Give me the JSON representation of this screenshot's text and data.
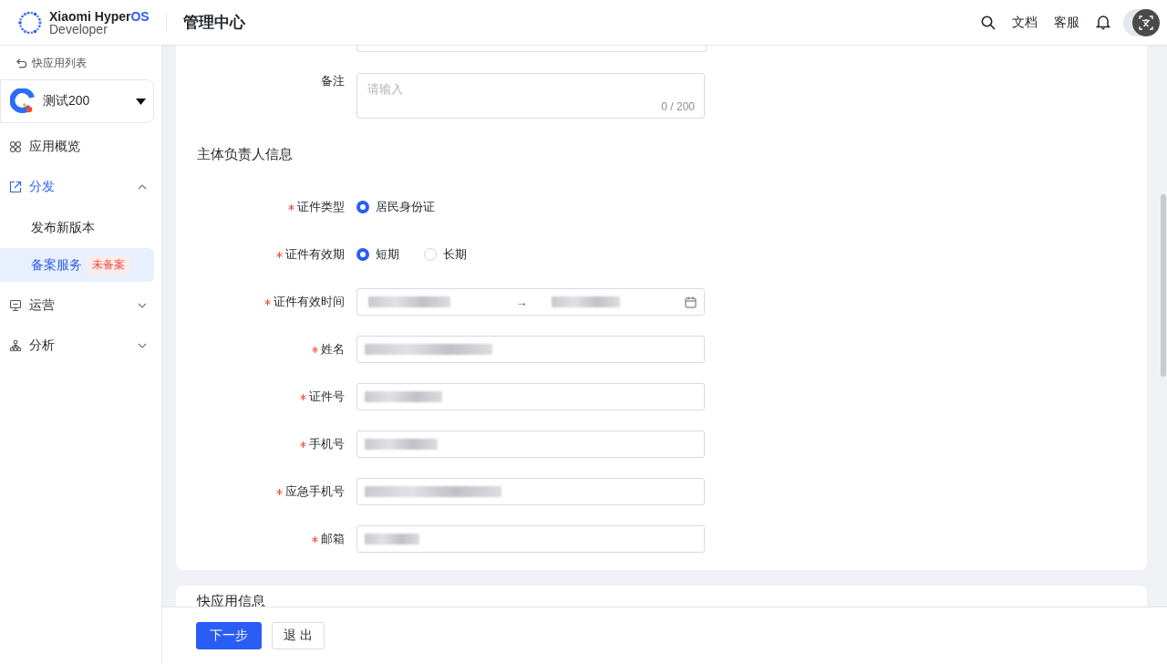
{
  "header": {
    "brand": "Xiaomi Hyper",
    "brand_accent": "OS",
    "subtitle": "Developer",
    "title": "管理中心",
    "links": [
      "文档",
      "客服"
    ]
  },
  "sidebar": {
    "back_link": "快应用列表",
    "app": {
      "name": "测试200"
    },
    "menu": [
      {
        "label": "应用概览",
        "kind": "link",
        "selected": false
      },
      {
        "label": "分发",
        "kind": "group",
        "selected": true,
        "expanded": true,
        "children": [
          {
            "label": "发布新版本",
            "selected": false
          },
          {
            "label": "备案服务",
            "selected": true,
            "badge": "未备案"
          }
        ]
      },
      {
        "label": "运营",
        "kind": "group",
        "selected": false,
        "expanded": false
      },
      {
        "label": "分析",
        "kind": "group",
        "selected": false,
        "expanded": false
      }
    ]
  },
  "form": {
    "note": {
      "label": "备注",
      "placeholder": "请输入",
      "counter": "0 / 200"
    },
    "section_title": "主体负责人信息",
    "fields": [
      {
        "label": "证件类型",
        "required": true,
        "kind": "radio",
        "options": [
          {
            "label": "居民身份证",
            "selected": true
          }
        ]
      },
      {
        "label": "证件有效期",
        "required": true,
        "kind": "radio",
        "options": [
          {
            "label": "短期",
            "selected": true
          },
          {
            "label": "长期",
            "selected": false
          }
        ]
      },
      {
        "label": "证件有效时间",
        "required": true,
        "kind": "daterange",
        "separator": "→"
      },
      {
        "label": "姓名",
        "required": true,
        "kind": "text"
      },
      {
        "label": "证件号",
        "required": true,
        "kind": "text"
      },
      {
        "label": "手机号",
        "required": true,
        "kind": "text"
      },
      {
        "label": "应急手机号",
        "required": true,
        "kind": "text"
      },
      {
        "label": "邮箱",
        "required": true,
        "kind": "text"
      }
    ],
    "next_section_title": "快应用信息"
  },
  "footer": {
    "buttons": [
      {
        "label": "下一步",
        "kind": "primary"
      },
      {
        "label": "退 出",
        "kind": "default"
      }
    ]
  }
}
